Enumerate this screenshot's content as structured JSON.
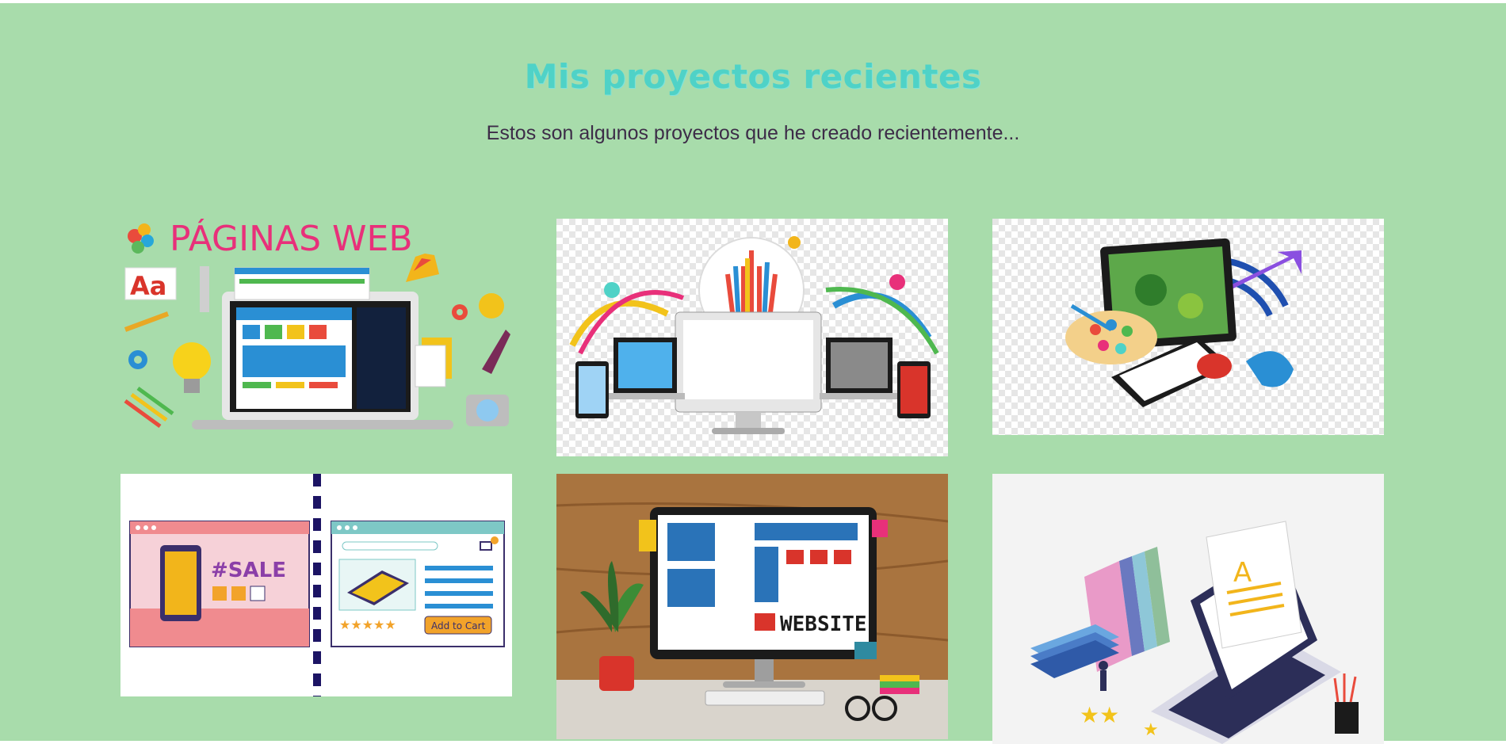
{
  "projects_section": {
    "title": "Mis proyectos recientes",
    "subtitle": "Estos son algunos proyectos que he creado recientemente..."
  },
  "projects": [
    {
      "image_text": "PÁGINAS WEB",
      "badge": "Aa"
    },
    {
      "image_text": ""
    },
    {
      "image_text": ""
    },
    {
      "image_text": "#SALE",
      "button": "Add to Cart"
    },
    {
      "image_text": "WEBSITE"
    },
    {
      "image_text": "A"
    }
  ],
  "colors": {
    "background": "#a8dcab",
    "title": "#4fd2c7",
    "subtitle": "#3d2c48"
  }
}
